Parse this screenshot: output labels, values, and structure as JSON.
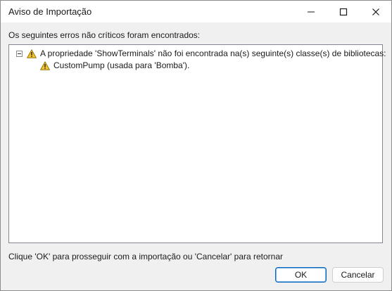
{
  "window": {
    "title": "Aviso de Importação"
  },
  "intro": {
    "text": "Os seguintes erros não críticos foram encontrados:"
  },
  "tree": {
    "items": [
      {
        "label": "A propriedade 'ShowTerminals' não foi encontrada na(s) seguinte(s) classe(s) de bibliotecas:",
        "icon": "warning-icon",
        "expanded": true,
        "children": [
          {
            "label": "CustomPump (usada para 'Bomba').",
            "icon": "warning-icon"
          }
        ]
      }
    ]
  },
  "footer": {
    "text": "Clique 'OK' para prosseguir com a importação ou 'Cancelar' para retornar"
  },
  "buttons": {
    "ok_label": "OK",
    "cancel_label": "Cancelar"
  },
  "colors": {
    "warning_fill": "#f2c12e",
    "accent": "#0067c0"
  }
}
